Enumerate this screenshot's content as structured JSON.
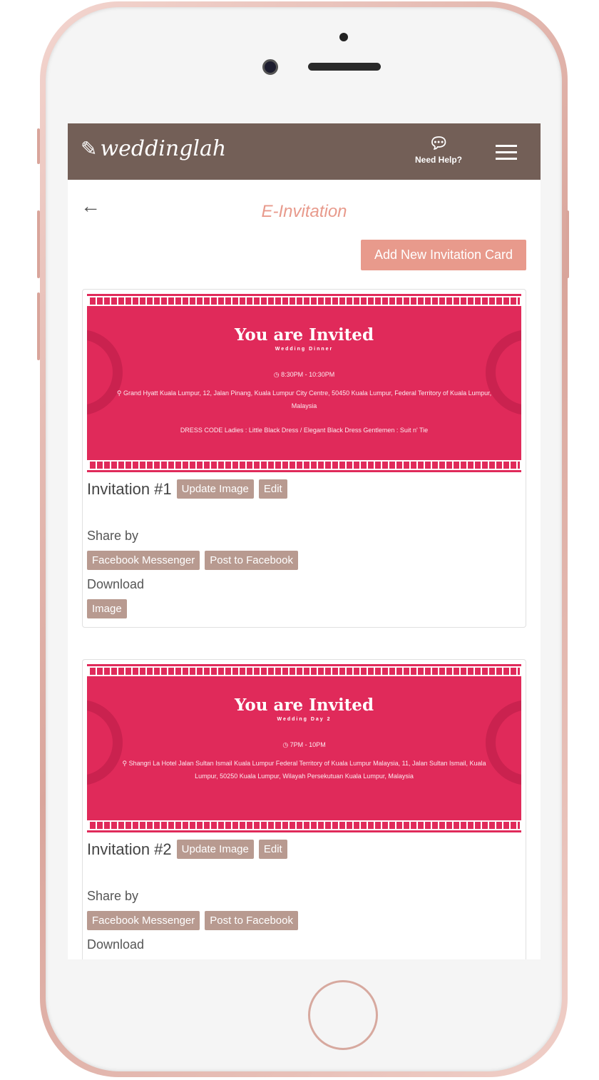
{
  "header": {
    "logo": "weddinglah",
    "help_label": "Need Help?"
  },
  "page": {
    "title": "E-Invitation",
    "add_button": "Add New Invitation Card"
  },
  "cards": [
    {
      "heading": "You are Invited",
      "subtitle": "Wedding Dinner",
      "time": "8:30PM - 10:30PM",
      "venue": "Grand Hyatt Kuala Lumpur, 12, Jalan Pinang, Kuala Lumpur City Centre, 50450 Kuala Lumpur, Federal Territory of Kuala Lumpur, Malaysia",
      "dress_code": "DRESS CODE Ladies : Little Black Dress / Elegant Black Dress Gentlemen : Suit n' Tie",
      "name": "Invitation #1",
      "update": "Update Image",
      "edit": "Edit",
      "share_by": "Share by",
      "messenger": "Facebook Messenger",
      "post": "Post to Facebook",
      "download": "Download",
      "image": "Image"
    },
    {
      "heading": "You are Invited",
      "subtitle": "Wedding Day 2",
      "time": "7PM - 10PM",
      "venue": "Shangri La Hotel Jalan Sultan Ismail Kuala Lumpur Federal Territory of Kuala Lumpur Malaysia, 11, Jalan Sultan Ismail, Kuala Lumpur, 50250 Kuala Lumpur, Wilayah Persekutuan Kuala Lumpur, Malaysia",
      "name": "Invitation #2",
      "update": "Update Image",
      "edit": "Edit",
      "share_by": "Share by",
      "messenger": "Facebook Messenger",
      "post": "Post to Facebook",
      "download": "Download"
    }
  ],
  "colors": {
    "header": "#735f57",
    "accent": "#e89a8c",
    "card": "#e02a5a",
    "button": "#b89a90"
  }
}
